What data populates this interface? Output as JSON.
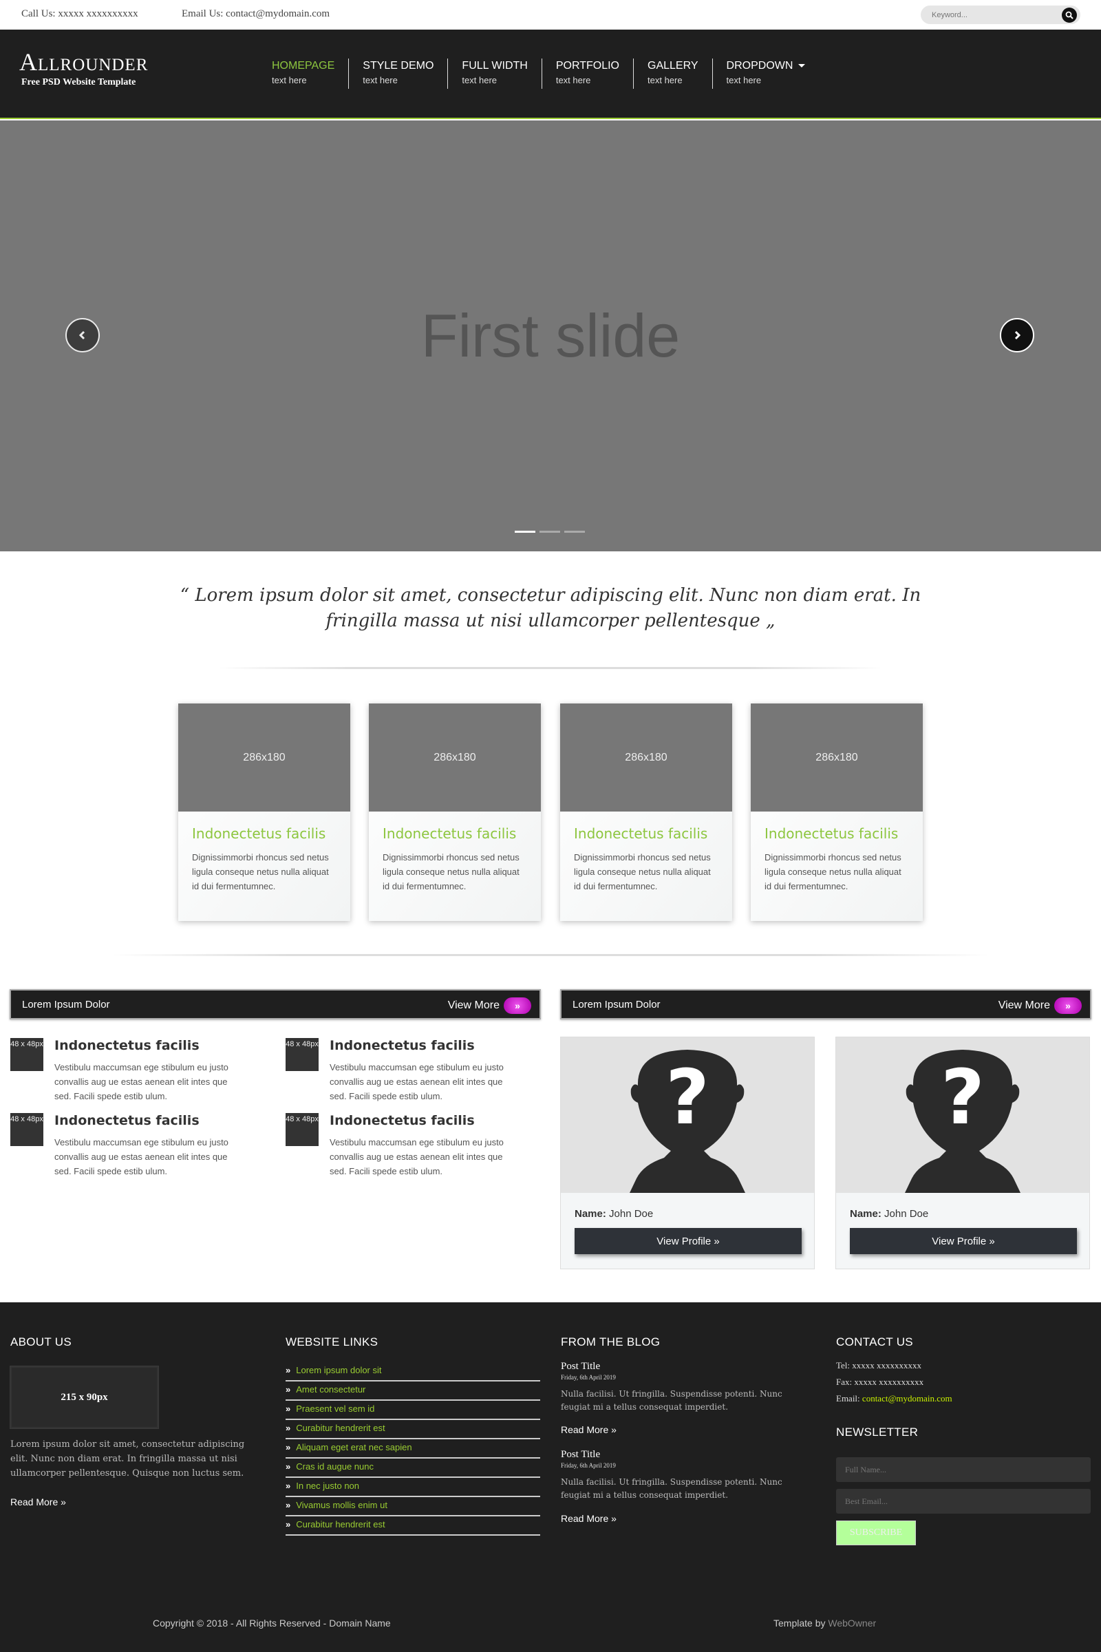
{
  "topbar": {
    "call": "Call Us: xxxxx xxxxxxxxxx",
    "email": "Email Us: contact@mydomain.com",
    "search_placeholder": "Keyword..."
  },
  "header": {
    "logo_title": "Allrounder",
    "logo_subtitle": "Free PSD Website Template",
    "nav": [
      {
        "label": "HOMEPAGE",
        "sub": "text here",
        "active": true
      },
      {
        "label": "STYLE DEMO",
        "sub": "text here"
      },
      {
        "label": "FULL WIDTH",
        "sub": "text here"
      },
      {
        "label": "PORTFOLIO",
        "sub": "text here"
      },
      {
        "label": "GALLERY",
        "sub": "text here"
      },
      {
        "label": "DROPDOWN",
        "sub": "text here",
        "dropdown": true
      }
    ]
  },
  "slider": {
    "text": "First slide",
    "slide_count": 3,
    "active_index": 0
  },
  "quote": "“ Lorem ipsum dolor sit amet, consectetur adipiscing elit. Nunc non diam erat. In fringilla massa ut nisi ullamcorper pellentesque „",
  "cards": [
    {
      "image": "286x180",
      "title": "Indonectetus facilis",
      "text": "Dignissimmorbi rhoncus sed netus ligula conseque netus nulla aliquat id dui fermentumnec."
    },
    {
      "image": "286x180",
      "title": "Indonectetus facilis",
      "text": "Dignissimmorbi rhoncus sed netus ligula conseque netus nulla aliquat id dui fermentumnec."
    },
    {
      "image": "286x180",
      "title": "Indonectetus facilis",
      "text": "Dignissimmorbi rhoncus sed netus ligula conseque netus nulla aliquat id dui fermentumnec."
    },
    {
      "image": "286x180",
      "title": "Indonectetus facilis",
      "text": "Dignissimmorbi rhoncus sed netus ligula conseque netus nulla aliquat id dui fermentumnec."
    }
  ],
  "news_panel": {
    "title": "Lorem Ipsum Dolor",
    "view_more": "View More",
    "items": [
      {
        "thumb": "48 x 48px",
        "title": "Indonectetus facilis",
        "text": "Vestibulu maccumsan ege stibulum eu justo convallis aug ue estas aenean elit intes que sed. Facili spede estib ulum."
      },
      {
        "thumb": "48 x 48px",
        "title": "Indonectetus facilis",
        "text": "Vestibulu maccumsan ege stibulum eu justo convallis aug ue estas aenean elit intes que sed. Facili spede estib ulum."
      },
      {
        "thumb": "48 x 48px",
        "title": "Indonectetus facilis",
        "text": "Vestibulu maccumsan ege stibulum eu justo convallis aug ue estas aenean elit intes que sed. Facili spede estib ulum."
      },
      {
        "thumb": "48 x 48px",
        "title": "Indonectetus facilis",
        "text": "Vestibulu maccumsan ege stibulum eu justo convallis aug ue estas aenean elit intes que sed. Facili spede estib ulum."
      }
    ]
  },
  "profile_panel": {
    "title": "Lorem Ipsum Dolor",
    "view_more": "View More",
    "profiles": [
      {
        "name_label": "Name:",
        "name": "John Doe",
        "button": "View Profile »"
      },
      {
        "name_label": "Name:",
        "name": "John Doe",
        "button": "View Profile »"
      }
    ]
  },
  "footer": {
    "about": {
      "heading": "ABOUT US",
      "logo": "215 x 90px",
      "text": "Lorem ipsum dolor sit amet, consectetur adipiscing elit. Nunc non diam erat. In fringilla massa ut nisi ullamcorper pellentesque. Quisque non luctus sem.",
      "read_more": "Read More »"
    },
    "links": {
      "heading": "WEBSITE LINKS",
      "items": [
        "Lorem ipsum dolor sit",
        "Amet consectetur",
        "Praesent vel sem id",
        "Curabitur hendrerit est",
        "Aliquam eget erat nec sapien",
        "Cras id augue nunc",
        "In nec justo non",
        "Vivamus mollis enim ut",
        "Curabitur hendrerit est"
      ]
    },
    "blog": {
      "heading": "FROM THE BLOG",
      "posts": [
        {
          "title": "Post Title",
          "date": "Friday, 6th April 2019",
          "text": "Nulla facilisi. Ut fringilla. Suspendisse potenti. Nunc feugiat mi a tellus consequat imperdiet.",
          "read_more": "Read More »"
        },
        {
          "title": "Post Title",
          "date": "Friday, 6th April 2019",
          "text": "Nulla facilisi. Ut fringilla. Suspendisse potenti. Nunc feugiat mi a tellus consequat imperdiet.",
          "read_more": "Read More »"
        }
      ]
    },
    "contact": {
      "heading": "CONTACT US",
      "tel": "Tel: xxxxx xxxxxxxxxx",
      "fax": "Fax: xxxxx xxxxxxxxxx",
      "email_label": "Email:",
      "email": "contact@mydomain.com"
    },
    "newsletter": {
      "heading": "NEWSLETTER",
      "name_placeholder": "Full Name...",
      "email_placeholder": "Best Email...",
      "button": "SUBSCRIBE"
    },
    "copyright": "Copyright © 2018 - All Rights Reserved - Domain Name",
    "credit_prefix": "Template by",
    "credit_link": "WebOwner"
  },
  "colors": {
    "accent_green": "#8dc63f",
    "dark": "#1f1f1f",
    "magenta": "#cc00cc",
    "slide_gray": "#777777"
  },
  "icons": {
    "search": "search-icon",
    "prev": "chevron-left-icon",
    "next": "chevron-right-icon",
    "profile": "unknown-person-icon"
  }
}
